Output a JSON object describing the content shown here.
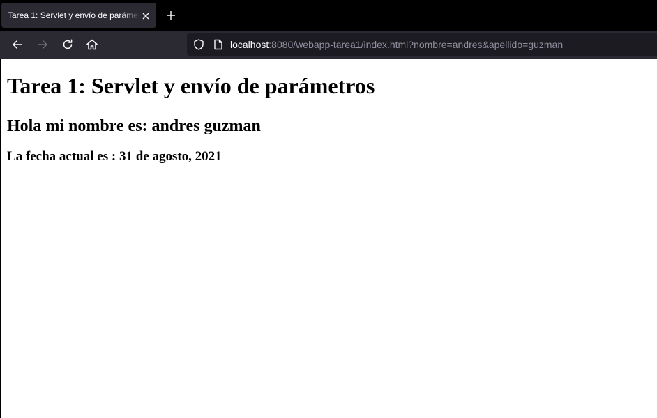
{
  "browser": {
    "tab": {
      "title": "Tarea 1: Servlet y envío de parámetros"
    },
    "address_bar": {
      "host": "localhost",
      "path": ":8080/webapp-tarea1/index.html?nombre=andres&apellido=guzman"
    },
    "icons": {
      "tab_close": "close-icon",
      "new_tab": "plus-icon",
      "back": "arrow-left-icon",
      "forward": "arrow-right-icon",
      "reload": "reload-icon",
      "home": "home-icon",
      "tracking_protection": "shield-icon",
      "page_info": "page-icon"
    },
    "colors": {
      "tabstrip_bg": "#000000",
      "toolbar_bg": "#2b2a33",
      "urlbar_bg": "#1c1b22",
      "text_light": "#fbfbfe",
      "text_dim": "#8f8f9d"
    }
  },
  "page": {
    "heading": "Tarea 1: Servlet y envío de parámetros",
    "greeting": "Hola mi nombre es: andres guzman",
    "date_line": "La fecha actual es : 31 de agosto, 2021"
  }
}
